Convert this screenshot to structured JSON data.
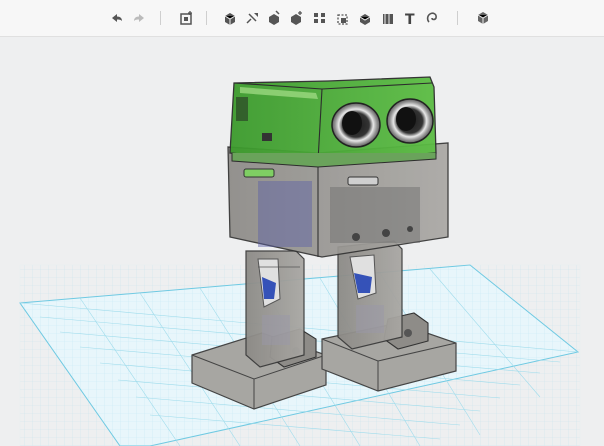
{
  "app": {
    "accent": "#5bb85b",
    "grid_color": "#7fd0e6"
  },
  "toolbar": {
    "items": [
      {
        "icon": "undo-icon"
      },
      {
        "icon": "redo-icon"
      },
      {
        "icon": "primitives-icon"
      },
      {
        "icon": "sketch-icon"
      },
      {
        "icon": "construct-icon"
      },
      {
        "icon": "modify-icon"
      },
      {
        "icon": "combine-icon"
      },
      {
        "icon": "pattern-icon"
      },
      {
        "icon": "snap-icon"
      },
      {
        "icon": "group-icon"
      },
      {
        "icon": "measure-icon"
      },
      {
        "icon": "text-icon",
        "glyph": "T"
      },
      {
        "icon": "material-icon"
      },
      {
        "icon": "view-cube-icon"
      }
    ]
  },
  "viewport": {
    "model": "robot",
    "workplane_grid": true
  }
}
